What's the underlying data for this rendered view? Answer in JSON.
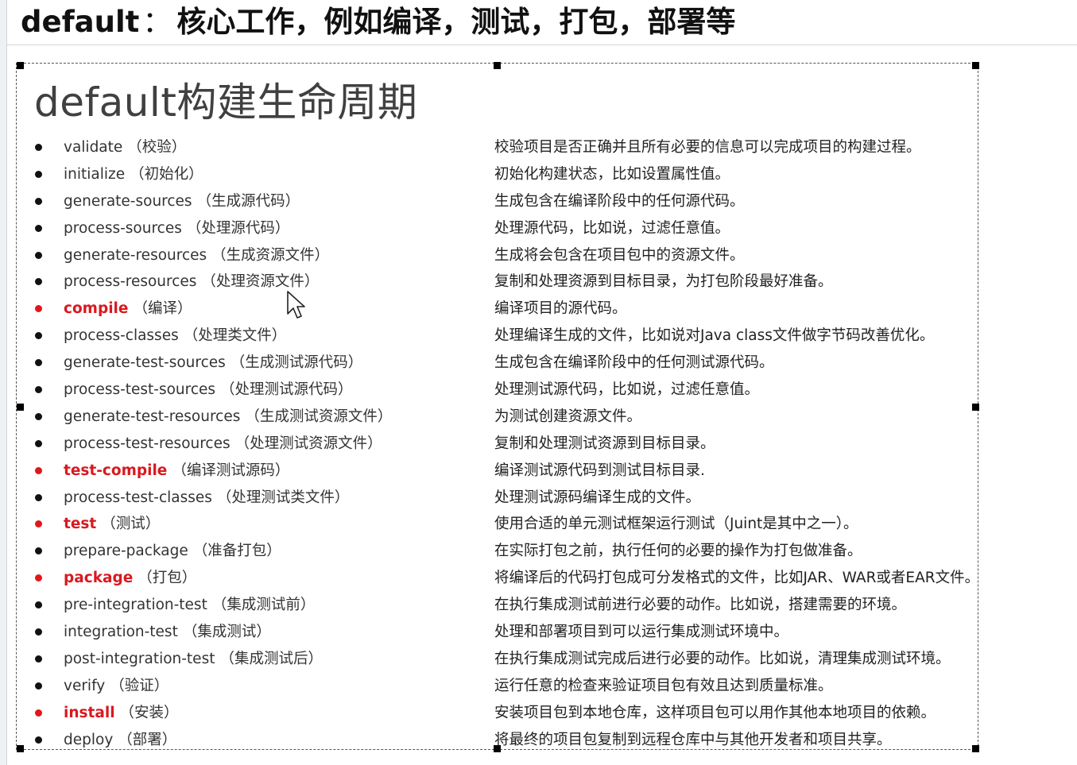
{
  "header": {
    "keyword": "default",
    "colon": "：",
    "text": "核心工作，例如编译，测试，打包，部署等"
  },
  "slide": {
    "title": "default构建生命周期",
    "phases": [
      {
        "name": "validate",
        "cn": "（校验）",
        "desc": "校验项目是否正确并且所有必要的信息可以完成项目的构建过程。",
        "highlight": false
      },
      {
        "name": "initialize",
        "cn": "（初始化）",
        "desc": "初始化构建状态，比如设置属性值。",
        "highlight": false
      },
      {
        "name": "generate-sources",
        "cn": "（生成源代码）",
        "desc": "生成包含在编译阶段中的任何源代码。",
        "highlight": false
      },
      {
        "name": "process-sources",
        "cn": "（处理源代码）",
        "desc": "处理源代码，比如说，过滤任意值。",
        "highlight": false
      },
      {
        "name": "generate-resources",
        "cn": "（生成资源文件）",
        "desc": "生成将会包含在项目包中的资源文件。",
        "highlight": false
      },
      {
        "name": "process-resources",
        "cn": "（处理资源文件）",
        "desc": "复制和处理资源到目标目录，为打包阶段最好准备。",
        "highlight": false
      },
      {
        "name": "compile",
        "cn": "（编译）",
        "desc": "编译项目的源代码。",
        "highlight": true
      },
      {
        "name": "process-classes",
        "cn": "（处理类文件）",
        "desc": "处理编译生成的文件，比如说对Java class文件做字节码改善优化。",
        "highlight": false
      },
      {
        "name": "generate-test-sources",
        "cn": "（生成测试源代码）",
        "desc": "生成包含在编译阶段中的任何测试源代码。",
        "highlight": false
      },
      {
        "name": "process-test-sources",
        "cn": "（处理测试源代码）",
        "desc": "处理测试源代码，比如说，过滤任意值。",
        "highlight": false
      },
      {
        "name": "generate-test-resources",
        "cn": "（生成测试资源文件）",
        "desc": "为测试创建资源文件。",
        "highlight": false
      },
      {
        "name": "process-test-resources",
        "cn": "（处理测试资源文件）",
        "desc": "复制和处理测试资源到目标目录。",
        "highlight": false
      },
      {
        "name": "test-compile",
        "cn": "（编译测试源码）",
        "desc": "编译测试源代码到测试目标目录.",
        "highlight": true
      },
      {
        "name": "process-test-classes",
        "cn": "（处理测试类文件）",
        "desc": "处理测试源码编译生成的文件。",
        "highlight": false
      },
      {
        "name": "test",
        "cn": "（测试）",
        "desc": "使用合适的单元测试框架运行测试（Juint是其中之一）。",
        "highlight": true
      },
      {
        "name": "prepare-package",
        "cn": "（准备打包）",
        "desc": "在实际打包之前，执行任何的必要的操作为打包做准备。",
        "highlight": false
      },
      {
        "name": "package",
        "cn": "（打包）",
        "desc": "将编译后的代码打包成可分发格式的文件，比如JAR、WAR或者EAR文件。",
        "highlight": true
      },
      {
        "name": "pre-integration-test",
        "cn": "（集成测试前）",
        "desc": "在执行集成测试前进行必要的动作。比如说，搭建需要的环境。",
        "highlight": false
      },
      {
        "name": "integration-test",
        "cn": "（集成测试）",
        "desc": "处理和部署项目到可以运行集成测试环境中。",
        "highlight": false
      },
      {
        "name": "post-integration-test",
        "cn": "（集成测试后）",
        "desc": "在执行集成测试完成后进行必要的动作。比如说，清理集成测试环境。",
        "highlight": false
      },
      {
        "name": "verify",
        "cn": "（验证）",
        "desc": "运行任意的检查来验证项目包有效且达到质量标准。",
        "highlight": false
      },
      {
        "name": "install",
        "cn": "（安装）",
        "desc": "安装项目包到本地仓库，这样项目包可以用作其他本地项目的依赖。",
        "highlight": true
      },
      {
        "name": "deploy",
        "cn": "（部署）",
        "desc": "将最终的项目包复制到远程仓库中与其他开发者和项目共享。",
        "highlight": false
      }
    ]
  },
  "colors": {
    "highlight": "#d9191f",
    "bullet": "#111111",
    "text": "#2b2b2b"
  },
  "icons": {
    "cursor": "mouse-pointer-icon",
    "handle": "resize-handle-icon"
  }
}
